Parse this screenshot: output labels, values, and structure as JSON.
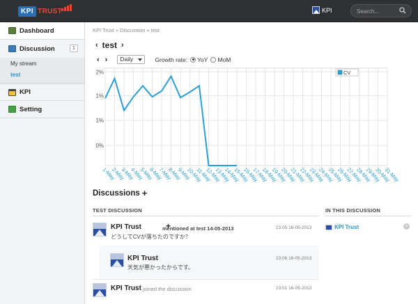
{
  "topbar": {
    "logo_kpi": "KPI",
    "logo_trust": "TRUST",
    "kpi_label": "KPI",
    "search_placeholder": "Search..."
  },
  "sidebar": {
    "items": [
      {
        "label": "Dashboard",
        "icon": "dashboard-icon"
      },
      {
        "label": "Discussion",
        "icon": "discussion-icon",
        "count": "1"
      },
      {
        "label": "KPI",
        "icon": "kpi-icon"
      },
      {
        "label": "Setting",
        "icon": "setting-icon"
      }
    ],
    "sub_items": [
      {
        "label": "My stream"
      },
      {
        "label": "test",
        "active": true
      }
    ]
  },
  "breadcrumb": "KPI Trust » Discussion » test",
  "page": {
    "title": "test",
    "period_select": "Daily",
    "growth_label": "Growth rate:",
    "yoy": "YoY",
    "mom": "MoM"
  },
  "colors": {
    "line": "#2a9fd6",
    "link": "#2a93c8",
    "topbar": "#2f3032"
  },
  "chart_data": {
    "type": "line",
    "y_ticks": [
      "2%",
      "1%",
      "1%",
      "0%"
    ],
    "x": [
      "1-May",
      "2-May",
      "3-May",
      "4-May",
      "5-May",
      "6-May",
      "7-May",
      "8-May",
      "9-May",
      "10-May",
      "11-May",
      "12-May",
      "13-May",
      "14-May",
      "15-May",
      "16-May",
      "17-May",
      "18-May",
      "19-May",
      "20-May",
      "21-May",
      "22-May",
      "23-May",
      "24-May",
      "25-May",
      "26-May",
      "27-May",
      "28-May",
      "29-May",
      "30-May",
      "31-May"
    ],
    "series": [
      {
        "name": "CV",
        "values": [
          1.28,
          1.82,
          0.95,
          1.32,
          1.62,
          1.32,
          1.48,
          1.88,
          1.3,
          1.45,
          1.62,
          -0.55,
          -0.55,
          -0.55,
          -0.55
        ]
      }
    ],
    "ylim": [
      -0.55,
      2.1
    ],
    "legend": "top-right",
    "grid": true
  },
  "discussions": {
    "title": "Discussions",
    "section_label": "TEST DISCUSSION",
    "right_label": "IN THIS DISCUSSION",
    "right_item": "KPI Trust",
    "posts": [
      {
        "name": "KPI Trust",
        "action": "mentioned at test 14-05-2013",
        "time": "23:05 16-05-2013",
        "text": "どうしてCVが落ちたのですか？"
      },
      {
        "name": "KPI Trust",
        "action": "",
        "time": "23:06 16-05-2013",
        "text": "天気が悪かったからです。"
      },
      {
        "name": "KPI Trust",
        "action": "joined the discussion",
        "time": "23:01 16-05-2013",
        "text": ""
      }
    ]
  }
}
